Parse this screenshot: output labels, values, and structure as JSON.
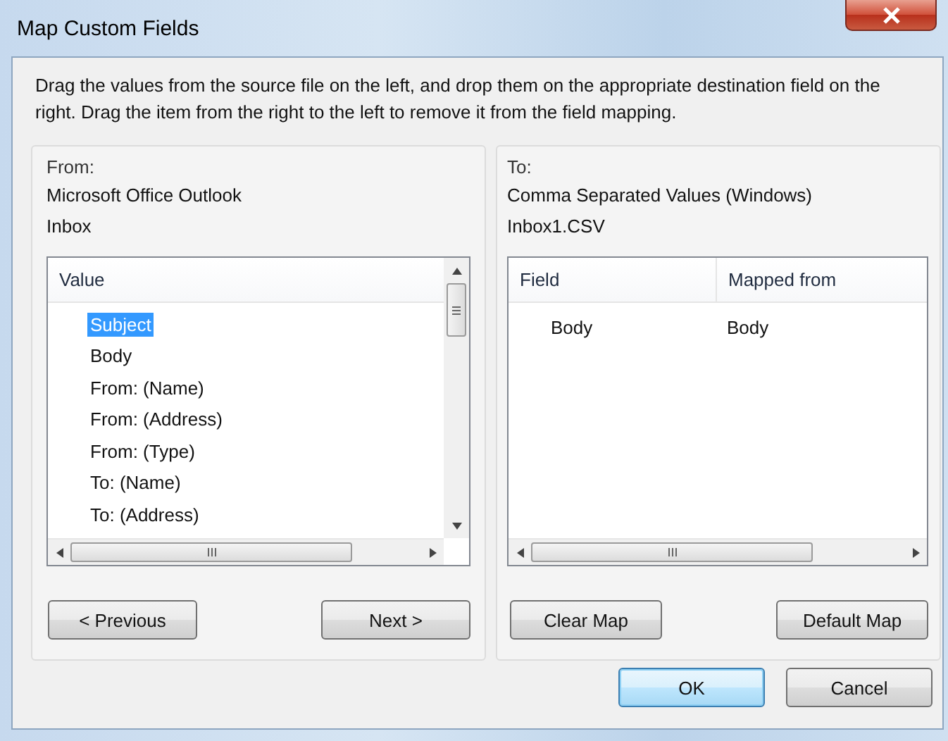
{
  "window": {
    "title": "Map Custom Fields"
  },
  "instructions": "Drag the values from the source file on the left, and drop them on the appropriate destination field on the right.  Drag the item from the right to the left to remove it from the field mapping.",
  "from": {
    "label": "From:",
    "lines": [
      "Microsoft Office Outlook",
      "Inbox"
    ],
    "list": {
      "column": "Value",
      "items": [
        {
          "text": "Subject",
          "selected": true
        },
        {
          "text": "Body",
          "selected": false
        },
        {
          "text": "From: (Name)",
          "selected": false
        },
        {
          "text": "From: (Address)",
          "selected": false
        },
        {
          "text": "From: (Type)",
          "selected": false
        },
        {
          "text": "To: (Name)",
          "selected": false
        },
        {
          "text": "To: (Address)",
          "selected": false
        }
      ]
    },
    "buttons": [
      "< Previous",
      "Next >"
    ]
  },
  "to": {
    "label": "To:",
    "lines": [
      "Comma Separated Values (Windows)",
      "Inbox1.CSV"
    ],
    "table": {
      "columns": [
        "Field",
        "Mapped from"
      ],
      "rows": [
        [
          "Body",
          "Body"
        ]
      ]
    },
    "buttons": [
      "Clear Map",
      "Default Map"
    ]
  },
  "footer_buttons": [
    {
      "label": "OK",
      "default": true
    },
    {
      "label": "Cancel",
      "default": false
    }
  ]
}
